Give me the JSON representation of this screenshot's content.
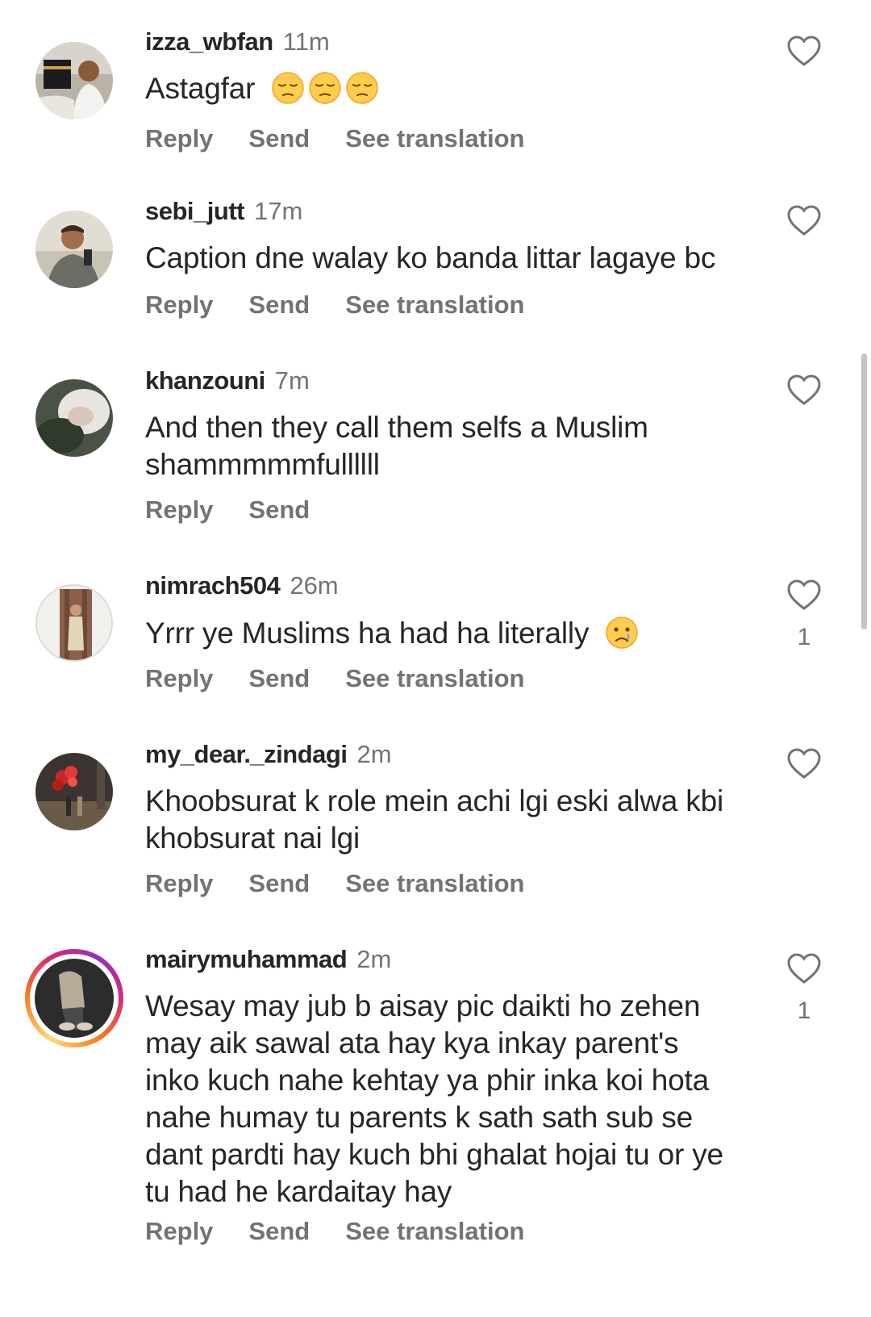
{
  "comments": [
    {
      "username": "izza_wbfan",
      "time": "11m",
      "text": "Astagfar",
      "emojis": [
        "pensive-face-emoji",
        "pensive-face-emoji",
        "pensive-face-emoji"
      ],
      "actions": {
        "reply": "Reply",
        "send": "Send",
        "translate": "See translation"
      },
      "likes": ""
    },
    {
      "username": "sebi_jutt",
      "time": "17m",
      "text": "Caption dne walay ko banda littar lagaye bc",
      "emojis": [],
      "actions": {
        "reply": "Reply",
        "send": "Send",
        "translate": "See translation"
      },
      "likes": ""
    },
    {
      "username": "khanzouni",
      "time": "7m",
      "text": "And then they call them selfs a Muslim shammmmmfullllll",
      "emojis": [],
      "actions": {
        "reply": "Reply",
        "send": "Send"
      },
      "likes": ""
    },
    {
      "username": "nimrach504",
      "time": "26m",
      "text": "Yrrr ye Muslims ha had ha literally",
      "emojis": [
        "crying-face-emoji"
      ],
      "actions": {
        "reply": "Reply",
        "send": "Send",
        "translate": "See translation"
      },
      "likes": "1"
    },
    {
      "username": "my_dear._zindagi",
      "time": "2m",
      "text": "Khoobsurat k role mein achi lgi eski alwa kbi khobsurat nai lgi",
      "emojis": [],
      "actions": {
        "reply": "Reply",
        "send": "Send",
        "translate": "See translation"
      },
      "likes": ""
    },
    {
      "username": "mairymuhammad",
      "time": "2m",
      "text": "Wesay may jub b aisay pic daikti ho zehen may aik sawal ata hay kya inkay parent's inko kuch nahe kehtay ya phir inka koi hota nahe humay tu parents k sath sath sub se dant pardti hay kuch bhi ghalat hojai tu or ye tu had he kardaitay hay",
      "emojis": [],
      "actions": {
        "reply": "Reply",
        "send": "Send",
        "translate": "See translation"
      },
      "likes": "1",
      "story_ring": true
    }
  ],
  "colors": {
    "primary_text": "#262626",
    "secondary_text": "#737373",
    "story_ring": [
      "#feda75",
      "#fa7e1e",
      "#d62976",
      "#962fbf"
    ]
  }
}
